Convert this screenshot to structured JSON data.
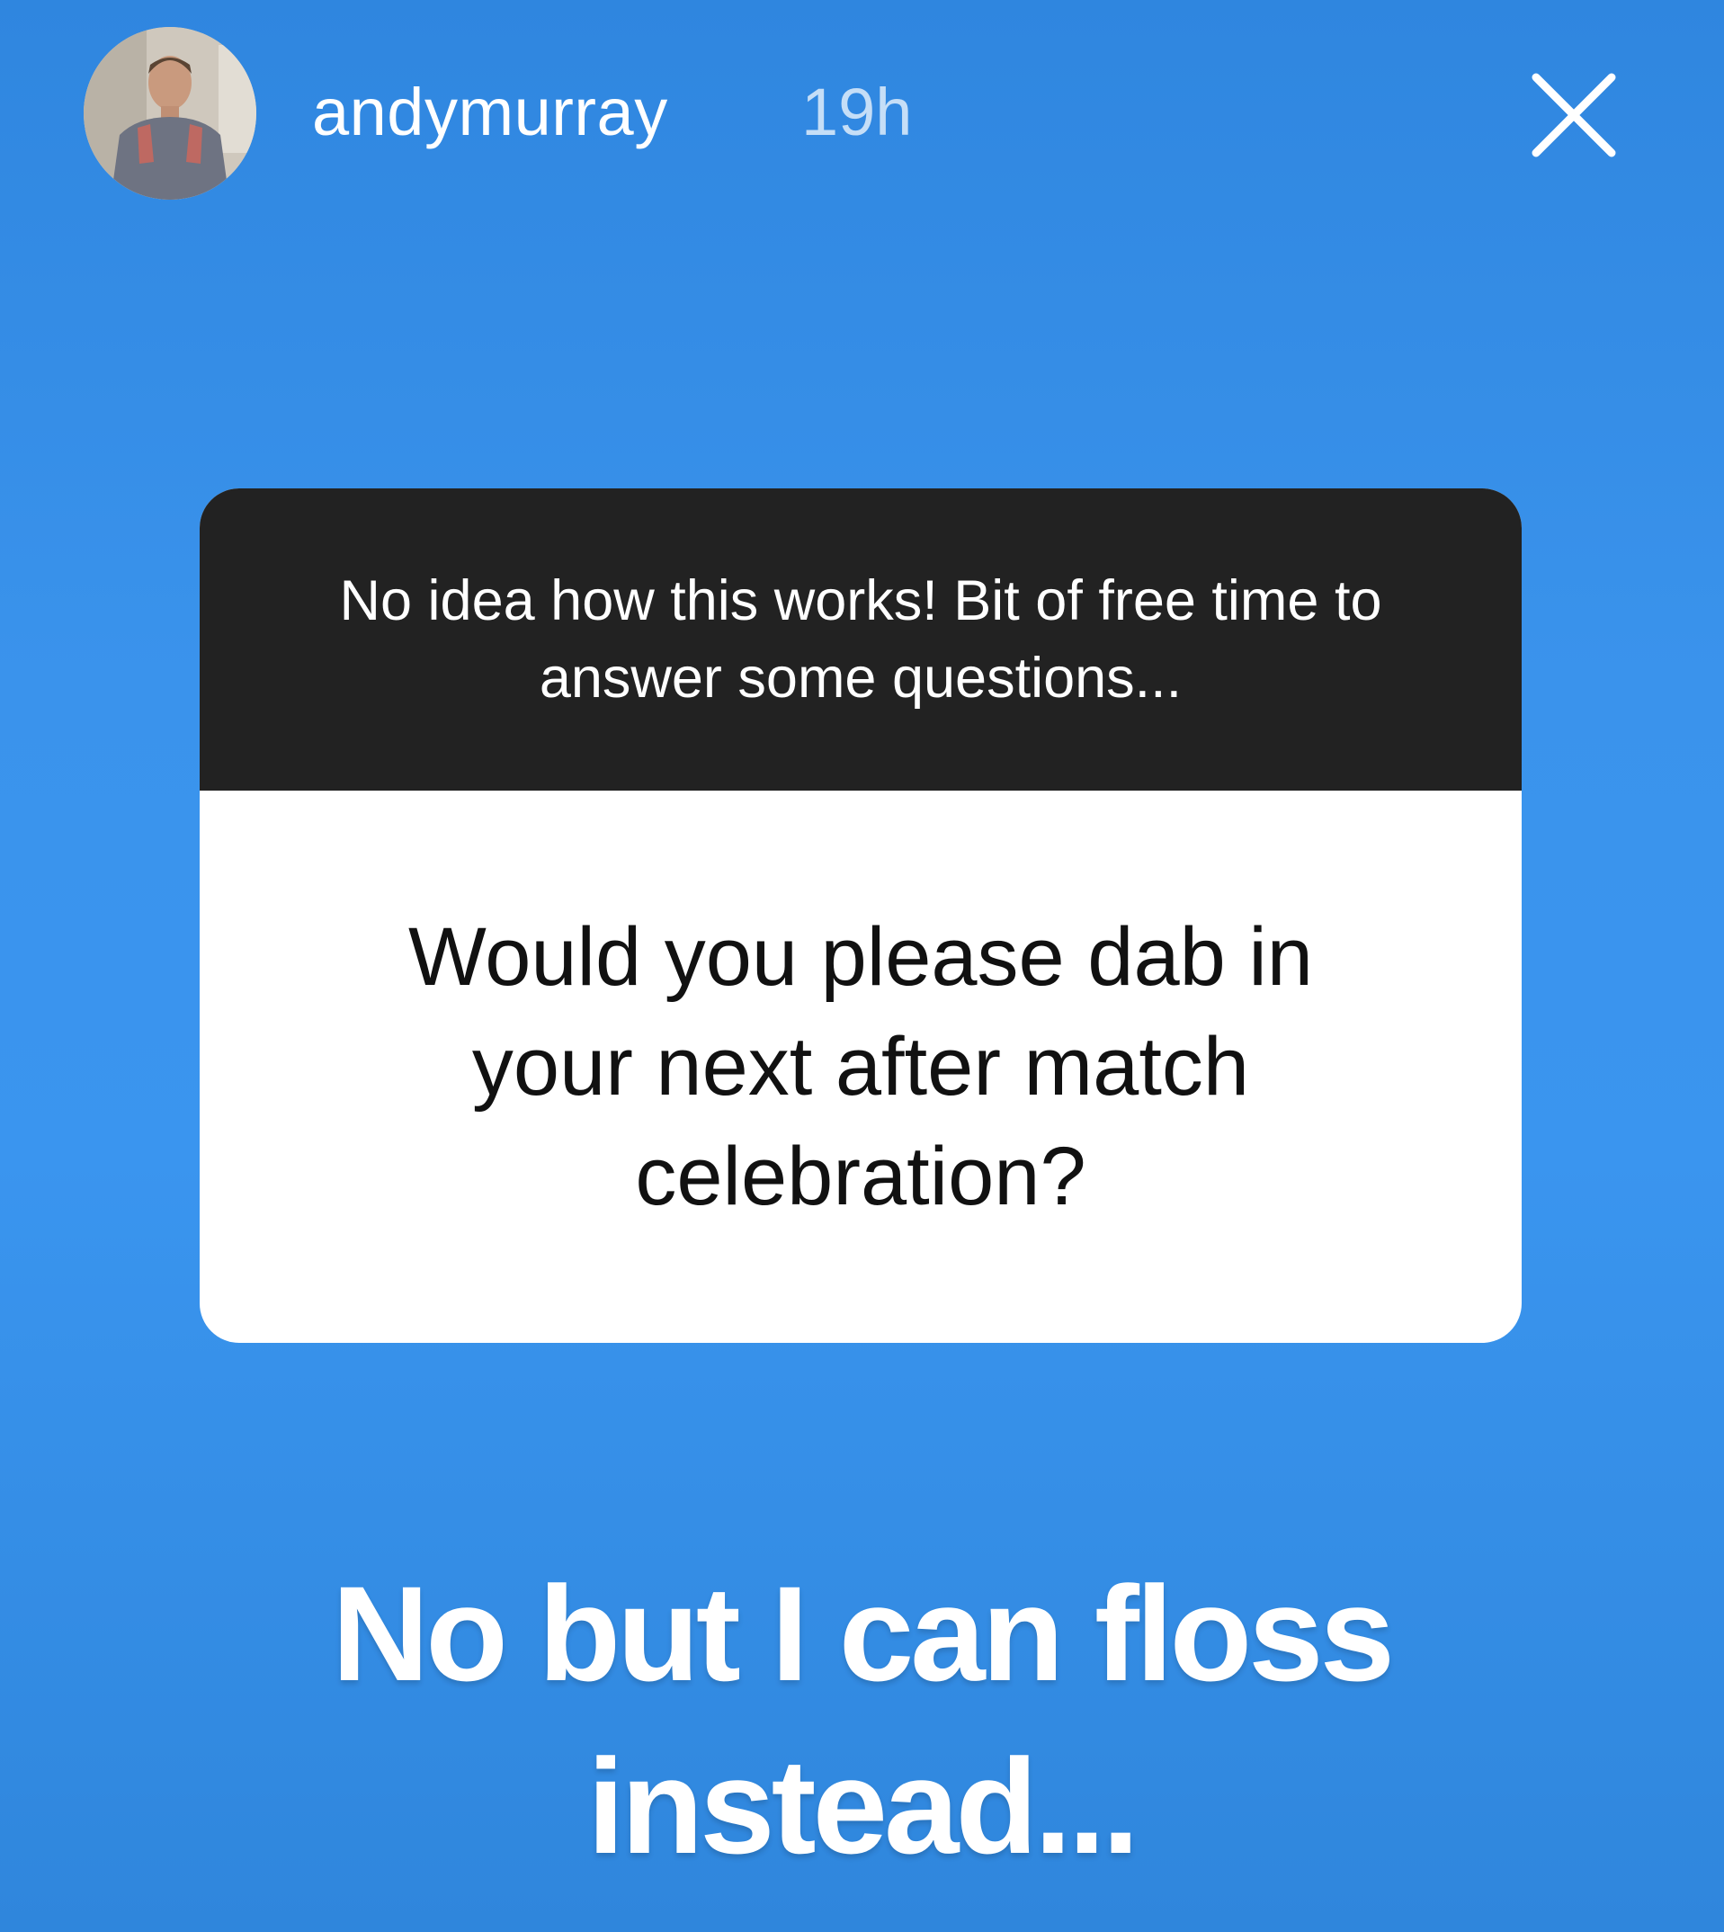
{
  "story": {
    "username": "andymurray",
    "timestamp": "19h",
    "close_icon": "close-icon",
    "avatar_icon": "profile-photo"
  },
  "sticker": {
    "prompt": "No idea how this works! Bit of free time to answer some questions...",
    "question": "Would you please dab in your next after match celebration?"
  },
  "answer": {
    "text": "No but I can floss instead..."
  },
  "colors": {
    "background": "#3a93ec",
    "sticker_header": "#222222",
    "sticker_body": "#ffffff",
    "text_light": "#ffffff"
  }
}
